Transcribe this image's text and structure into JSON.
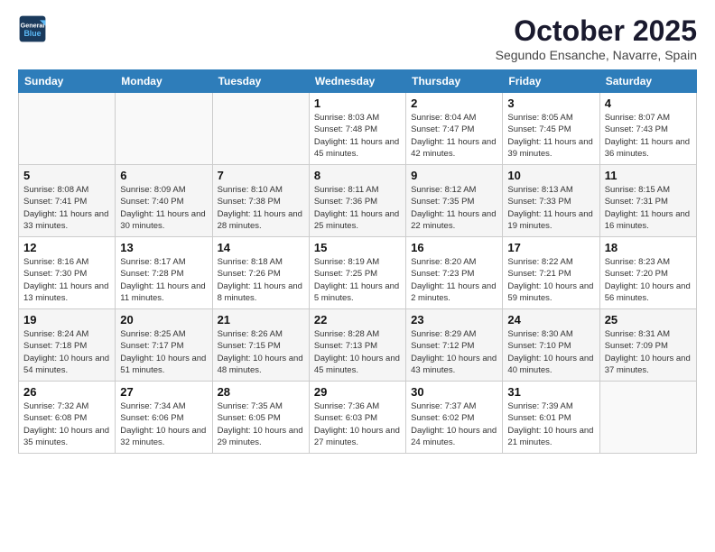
{
  "logo": {
    "line1": "General",
    "line2": "Blue"
  },
  "title": "October 2025",
  "subtitle": "Segundo Ensanche, Navarre, Spain",
  "weekdays": [
    "Sunday",
    "Monday",
    "Tuesday",
    "Wednesday",
    "Thursday",
    "Friday",
    "Saturday"
  ],
  "weeks": [
    [
      {
        "day": "",
        "info": ""
      },
      {
        "day": "",
        "info": ""
      },
      {
        "day": "",
        "info": ""
      },
      {
        "day": "1",
        "info": "Sunrise: 8:03 AM\nSunset: 7:48 PM\nDaylight: 11 hours\nand 45 minutes."
      },
      {
        "day": "2",
        "info": "Sunrise: 8:04 AM\nSunset: 7:47 PM\nDaylight: 11 hours\nand 42 minutes."
      },
      {
        "day": "3",
        "info": "Sunrise: 8:05 AM\nSunset: 7:45 PM\nDaylight: 11 hours\nand 39 minutes."
      },
      {
        "day": "4",
        "info": "Sunrise: 8:07 AM\nSunset: 7:43 PM\nDaylight: 11 hours\nand 36 minutes."
      }
    ],
    [
      {
        "day": "5",
        "info": "Sunrise: 8:08 AM\nSunset: 7:41 PM\nDaylight: 11 hours\nand 33 minutes."
      },
      {
        "day": "6",
        "info": "Sunrise: 8:09 AM\nSunset: 7:40 PM\nDaylight: 11 hours\nand 30 minutes."
      },
      {
        "day": "7",
        "info": "Sunrise: 8:10 AM\nSunset: 7:38 PM\nDaylight: 11 hours\nand 28 minutes."
      },
      {
        "day": "8",
        "info": "Sunrise: 8:11 AM\nSunset: 7:36 PM\nDaylight: 11 hours\nand 25 minutes."
      },
      {
        "day": "9",
        "info": "Sunrise: 8:12 AM\nSunset: 7:35 PM\nDaylight: 11 hours\nand 22 minutes."
      },
      {
        "day": "10",
        "info": "Sunrise: 8:13 AM\nSunset: 7:33 PM\nDaylight: 11 hours\nand 19 minutes."
      },
      {
        "day": "11",
        "info": "Sunrise: 8:15 AM\nSunset: 7:31 PM\nDaylight: 11 hours\nand 16 minutes."
      }
    ],
    [
      {
        "day": "12",
        "info": "Sunrise: 8:16 AM\nSunset: 7:30 PM\nDaylight: 11 hours\nand 13 minutes."
      },
      {
        "day": "13",
        "info": "Sunrise: 8:17 AM\nSunset: 7:28 PM\nDaylight: 11 hours\nand 11 minutes."
      },
      {
        "day": "14",
        "info": "Sunrise: 8:18 AM\nSunset: 7:26 PM\nDaylight: 11 hours\nand 8 minutes."
      },
      {
        "day": "15",
        "info": "Sunrise: 8:19 AM\nSunset: 7:25 PM\nDaylight: 11 hours\nand 5 minutes."
      },
      {
        "day": "16",
        "info": "Sunrise: 8:20 AM\nSunset: 7:23 PM\nDaylight: 11 hours\nand 2 minutes."
      },
      {
        "day": "17",
        "info": "Sunrise: 8:22 AM\nSunset: 7:21 PM\nDaylight: 10 hours\nand 59 minutes."
      },
      {
        "day": "18",
        "info": "Sunrise: 8:23 AM\nSunset: 7:20 PM\nDaylight: 10 hours\nand 56 minutes."
      }
    ],
    [
      {
        "day": "19",
        "info": "Sunrise: 8:24 AM\nSunset: 7:18 PM\nDaylight: 10 hours\nand 54 minutes."
      },
      {
        "day": "20",
        "info": "Sunrise: 8:25 AM\nSunset: 7:17 PM\nDaylight: 10 hours\nand 51 minutes."
      },
      {
        "day": "21",
        "info": "Sunrise: 8:26 AM\nSunset: 7:15 PM\nDaylight: 10 hours\nand 48 minutes."
      },
      {
        "day": "22",
        "info": "Sunrise: 8:28 AM\nSunset: 7:13 PM\nDaylight: 10 hours\nand 45 minutes."
      },
      {
        "day": "23",
        "info": "Sunrise: 8:29 AM\nSunset: 7:12 PM\nDaylight: 10 hours\nand 43 minutes."
      },
      {
        "day": "24",
        "info": "Sunrise: 8:30 AM\nSunset: 7:10 PM\nDaylight: 10 hours\nand 40 minutes."
      },
      {
        "day": "25",
        "info": "Sunrise: 8:31 AM\nSunset: 7:09 PM\nDaylight: 10 hours\nand 37 minutes."
      }
    ],
    [
      {
        "day": "26",
        "info": "Sunrise: 7:32 AM\nSunset: 6:08 PM\nDaylight: 10 hours\nand 35 minutes."
      },
      {
        "day": "27",
        "info": "Sunrise: 7:34 AM\nSunset: 6:06 PM\nDaylight: 10 hours\nand 32 minutes."
      },
      {
        "day": "28",
        "info": "Sunrise: 7:35 AM\nSunset: 6:05 PM\nDaylight: 10 hours\nand 29 minutes."
      },
      {
        "day": "29",
        "info": "Sunrise: 7:36 AM\nSunset: 6:03 PM\nDaylight: 10 hours\nand 27 minutes."
      },
      {
        "day": "30",
        "info": "Sunrise: 7:37 AM\nSunset: 6:02 PM\nDaylight: 10 hours\nand 24 minutes."
      },
      {
        "day": "31",
        "info": "Sunrise: 7:39 AM\nSunset: 6:01 PM\nDaylight: 10 hours\nand 21 minutes."
      },
      {
        "day": "",
        "info": ""
      }
    ]
  ]
}
